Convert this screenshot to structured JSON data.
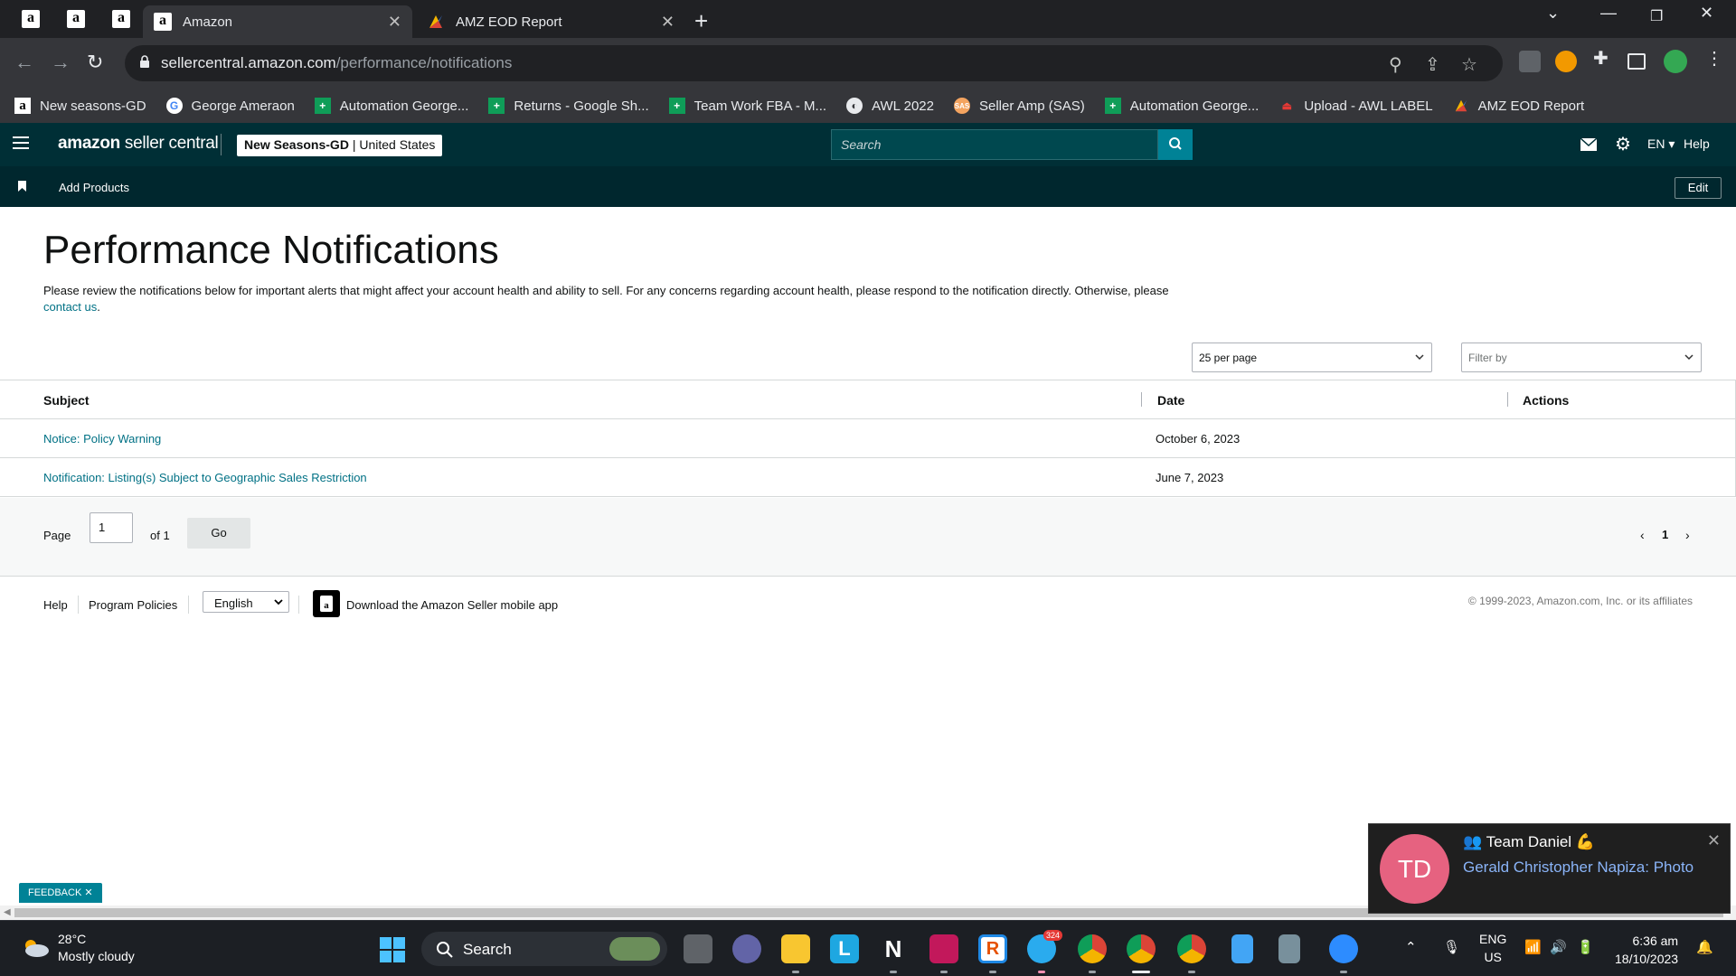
{
  "browser": {
    "tabs": [
      {
        "label": "Amazon",
        "active": true
      },
      {
        "label": "AMZ EOD Report",
        "active": false
      }
    ],
    "url": {
      "host": "sellercentral.amazon.com",
      "path": "/performance/notifications"
    },
    "bookmarks": [
      "New seasons-GD",
      "George Ameraon",
      "Automation George...",
      "Returns - Google Sh...",
      "Team Work FBA - M...",
      "AWL 2022",
      "Seller Amp (SAS)",
      "Automation George...",
      "Upload - AWL LABEL",
      "AMZ EOD Report"
    ]
  },
  "header": {
    "logo_bold": "amazon",
    "logo_light": " seller central",
    "store_name": "New Seasons-GD",
    "store_region": " | United States",
    "search_placeholder": "Search",
    "lang": "EN",
    "help": "Help"
  },
  "subnav": {
    "add_products": "Add Products",
    "edit": "Edit"
  },
  "main": {
    "title": "Performance Notifications",
    "desc_before": "Please review the notifications below for important alerts that might affect your account health and ability to sell. For any concerns regarding account health, please respond to the notification directly. Otherwise, please ",
    "desc_link": "contact us",
    "desc_after": ".",
    "per_page": "25 per page",
    "filter_placeholder": "Filter by",
    "columns": {
      "subject": "Subject",
      "date": "Date",
      "actions": "Actions"
    },
    "rows": [
      {
        "subject": "Notice: Policy Warning",
        "date": "October 6, 2023"
      },
      {
        "subject": "Notification: Listing(s) Subject to Geographic Sales Restriction",
        "date": "June 7, 2023"
      }
    ],
    "pager": {
      "page_label": "Page",
      "page_value": "1",
      "of_label": "of 1",
      "go": "Go",
      "current": "1"
    }
  },
  "footer": {
    "help": "Help",
    "policies": "Program Policies",
    "language": "English",
    "download_app": "Download the Amazon Seller mobile app",
    "copyright": "© 1999-2023, Amazon.com, Inc. or its affiliates"
  },
  "feedback": "FEEDBACK",
  "toast": {
    "avatar": "TD",
    "title": "Team Daniel 💪",
    "body": "Gerald Christopher Napiza: Photo"
  },
  "taskbar": {
    "temperature": "28°C",
    "condition": "Mostly cloudy",
    "search": "Search",
    "badge_telegram": "324",
    "lang1": "ENG",
    "lang2": "US",
    "time": "6:36 am",
    "date": "18/10/2023"
  },
  "colors": {
    "header_bg": "#002f36",
    "subnav_bg": "#00272e",
    "link": "#007185",
    "search_btn": "#008296"
  }
}
